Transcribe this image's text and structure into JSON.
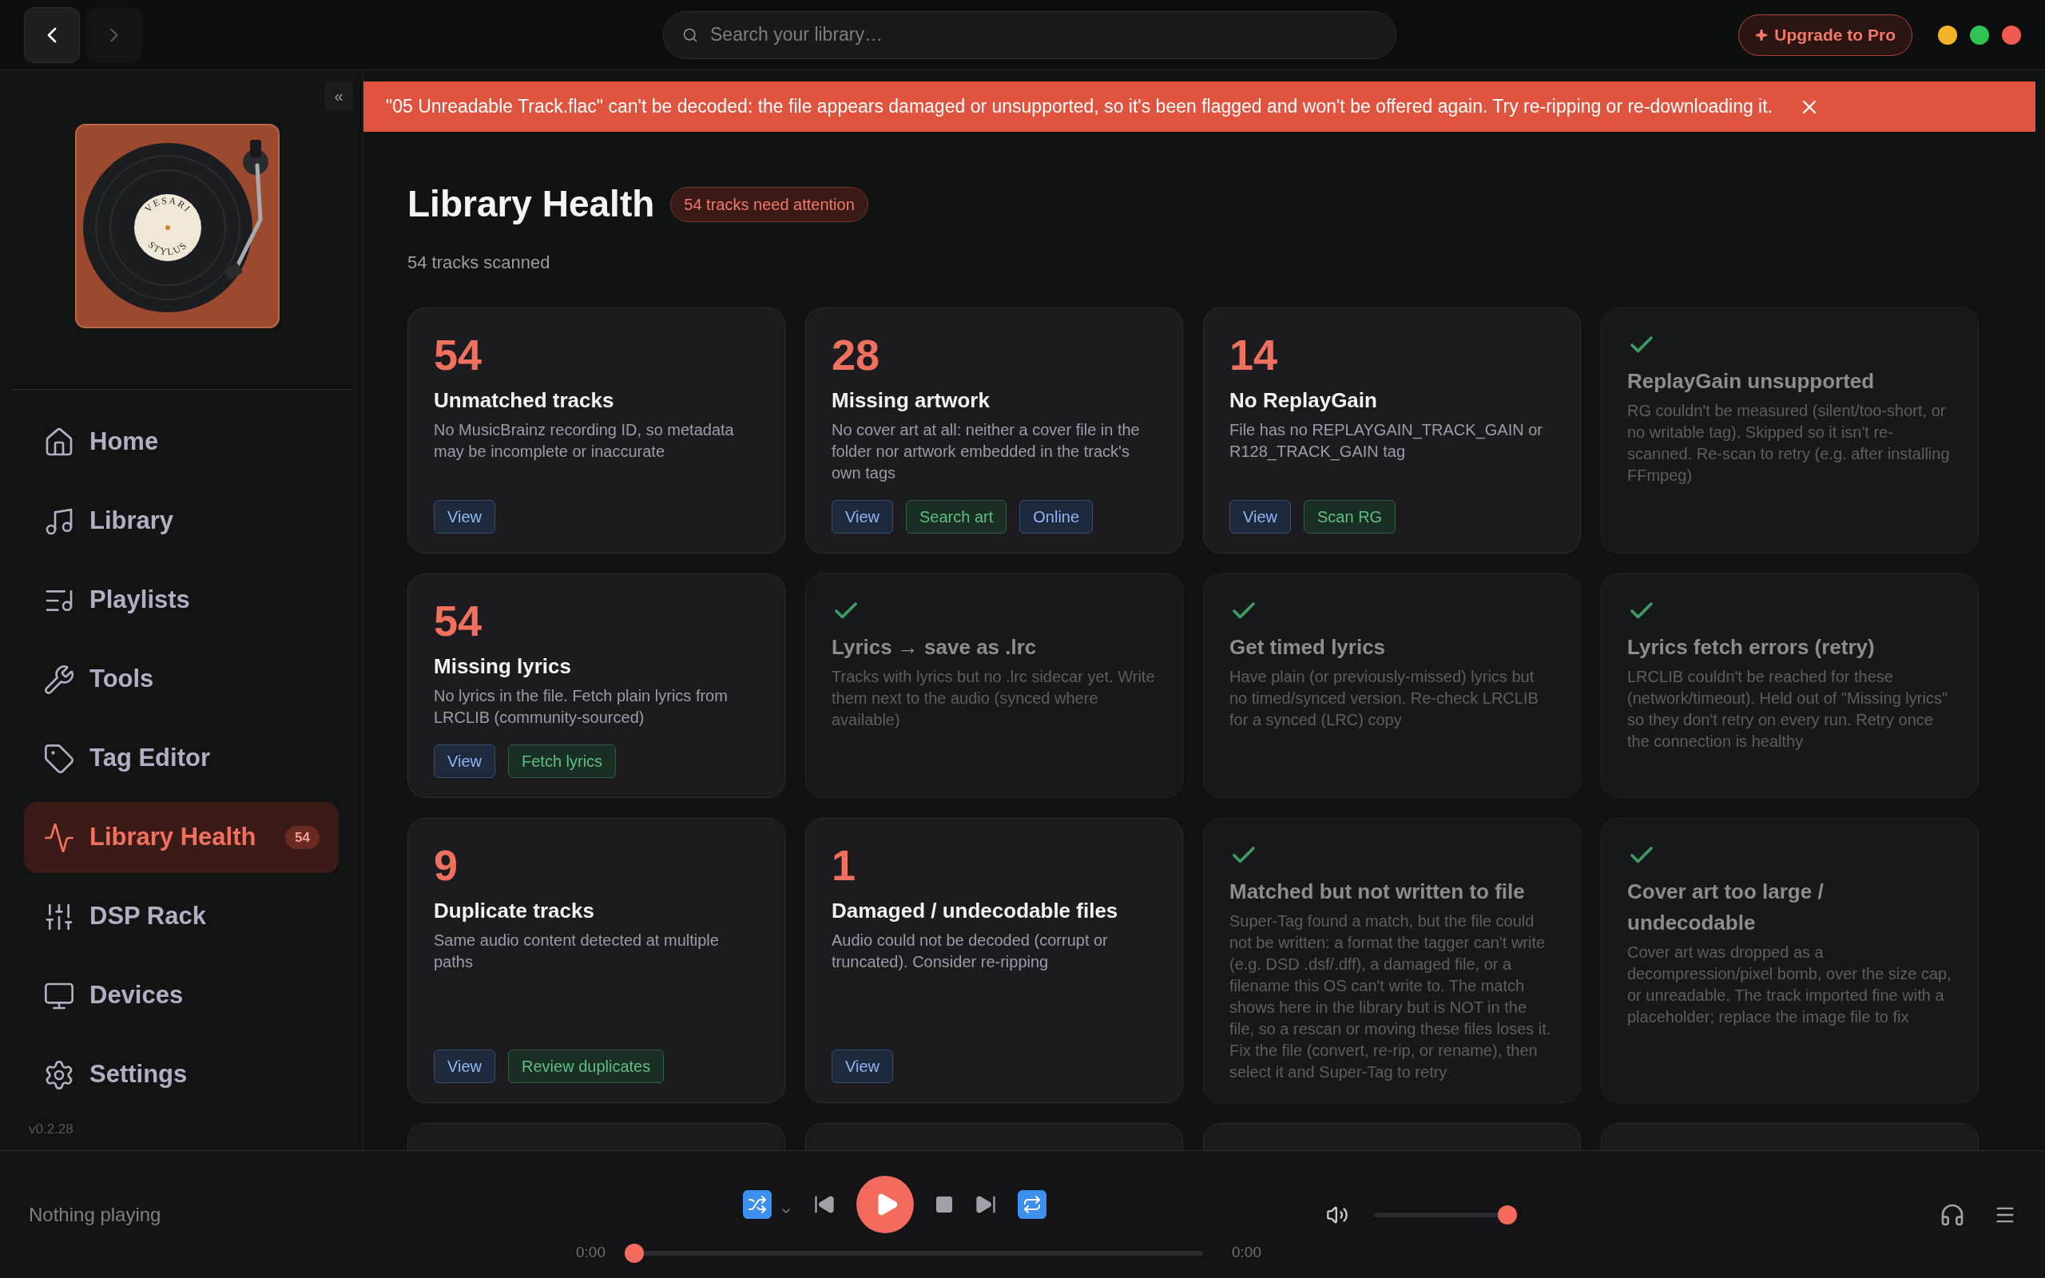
{
  "nav": {
    "back_disabled": false,
    "forward_disabled": true
  },
  "search": {
    "placeholder": "Search your library…"
  },
  "upgrade_button": "Upgrade to Pro",
  "sidebar": {
    "collapse": "«",
    "logo": {
      "top_text": "VESARI",
      "bottom_text": "STYLUS"
    },
    "items": [
      {
        "label": "Home",
        "selected": false
      },
      {
        "label": "Library",
        "selected": false
      },
      {
        "label": "Playlists",
        "selected": false
      },
      {
        "label": "Tools",
        "selected": false
      },
      {
        "label": "Tag Editor",
        "selected": false
      },
      {
        "label": "Library Health",
        "selected": true,
        "badge": "54"
      },
      {
        "label": "DSP Rack",
        "selected": false
      },
      {
        "label": "Devices",
        "selected": false
      },
      {
        "label": "Settings",
        "selected": false
      }
    ],
    "version": "v0.2.28"
  },
  "banner": {
    "message": "\"05 Unreadable Track.flac\" can't be decoded: the file appears damaged or unsupported, so it's been flagged and won't be offered again. Try re-ripping or re-downloading it."
  },
  "header": {
    "title": "Library Health",
    "badge": "54 tracks need attention",
    "subtitle": "54 tracks scanned"
  },
  "cards": [
    {
      "kind": "count",
      "count": "54",
      "title": "Unmatched tracks",
      "description": "No MusicBrainz recording ID, so metadata may be incomplete or inaccurate",
      "buttons": [
        {
          "label": "View",
          "kind": "navigate"
        }
      ]
    },
    {
      "kind": "count",
      "count": "28",
      "title": "Missing artwork",
      "description": "No cover art at all: neither a cover file in the folder nor artwork embedded in the track's own tags",
      "buttons": [
        {
          "label": "View",
          "kind": "navigate"
        },
        {
          "label": "Search art",
          "kind": "fix"
        },
        {
          "label": "Online",
          "kind": "navigate"
        }
      ]
    },
    {
      "kind": "count",
      "count": "14",
      "title": "No ReplayGain",
      "description": "File has no REPLAYGAIN_TRACK_GAIN or R128_TRACK_GAIN tag",
      "buttons": [
        {
          "label": "View",
          "kind": "navigate"
        },
        {
          "label": "Scan RG",
          "kind": "fix"
        }
      ]
    },
    {
      "kind": "resolved",
      "title": "ReplayGain unsupported",
      "description": "RG couldn't be measured (silent/too-short, or no writable tag). Skipped so it isn't re-scanned. Re-scan to retry (e.g. after installing FFmpeg)"
    },
    {
      "kind": "count",
      "count": "54",
      "title": "Missing lyrics",
      "description": "No lyrics in the file. Fetch plain lyrics from LRCLIB (community-sourced)",
      "buttons": [
        {
          "label": "View",
          "kind": "navigate"
        },
        {
          "label": "Fetch lyrics",
          "kind": "fix"
        }
      ]
    },
    {
      "kind": "resolved",
      "title": "Lyrics → save as .lrc",
      "description": "Tracks with lyrics but no .lrc sidecar yet. Write them next to the audio (synced where available)"
    },
    {
      "kind": "resolved",
      "title": "Get timed lyrics",
      "description": "Have plain (or previously-missed) lyrics but no timed/synced version. Re-check LRCLIB for a synced (LRC) copy"
    },
    {
      "kind": "resolved",
      "title": "Lyrics fetch errors (retry)",
      "description": "LRCLIB couldn't be reached for these (network/timeout). Held out of \"Missing lyrics\" so they don't retry on every run. Retry once the connection is healthy"
    },
    {
      "kind": "count",
      "count": "9",
      "title": "Duplicate tracks",
      "description": "Same audio content detected at multiple paths",
      "buttons": [
        {
          "label": "View",
          "kind": "navigate"
        },
        {
          "label": "Review duplicates",
          "kind": "fix"
        }
      ]
    },
    {
      "kind": "count",
      "count": "1",
      "title": "Damaged / undecodable files",
      "description": "Audio could not be decoded (corrupt or truncated). Consider re-ripping",
      "buttons": [
        {
          "label": "View",
          "kind": "navigate"
        }
      ]
    },
    {
      "kind": "resolved",
      "title": "Matched but not written to file",
      "description": "Super-Tag found a match, but the file could not be written: a format the tagger can't write (e.g. DSD .dsf/.dff), a damaged file, or a filename this OS can't write to. The match shows here in the library but is NOT in the file, so a rescan or moving these files loses it. Fix the file (convert, re-rip, or rename), then select it and Super-Tag to retry"
    },
    {
      "kind": "resolved",
      "title": "Cover art too large / undecodable",
      "description": "Cover art was dropped as a decompression/pixel bomb, over the size cap, or unreadable. The track imported fine with a placeholder; replace the image file to fix"
    }
  ],
  "player": {
    "status": "Nothing playing",
    "shuffle": {
      "on": true
    },
    "repeat": {
      "on": true
    },
    "elapsed": "0:00",
    "duration": "0:00",
    "progress": {
      "level": 0
    },
    "volume": {
      "level": 1
    }
  }
}
